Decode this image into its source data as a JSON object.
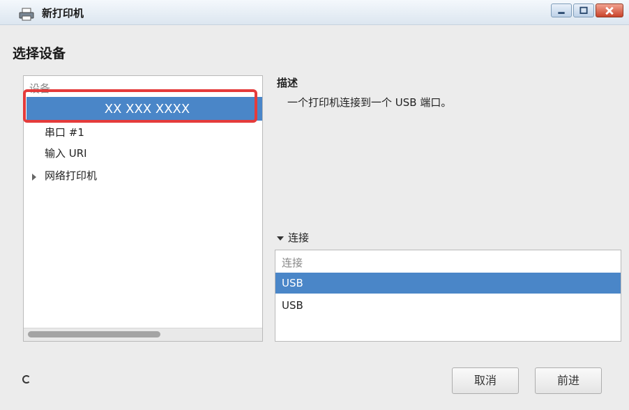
{
  "window": {
    "title": "新打印机",
    "icon": "printer-icon",
    "controls": [
      "minimize-icon",
      "maximize-icon",
      "close-icon"
    ]
  },
  "page": {
    "heading": "选择设备"
  },
  "devices": {
    "column_header": "设备",
    "items": [
      {
        "label": "XX XXX XXXX",
        "selected": true
      },
      {
        "label": "串口 #1"
      },
      {
        "label": "输入 URI"
      },
      {
        "label": "网络打印机",
        "expandable": true
      }
    ]
  },
  "description": {
    "label": "描述",
    "text": "一个打印机连接到一个 USB 端口。"
  },
  "connection": {
    "toggle_label": "连接",
    "column_header": "连接",
    "rows": [
      {
        "label": "USB",
        "selected": true
      },
      {
        "label": "USB"
      }
    ]
  },
  "buttons": {
    "cancel": "取消",
    "forward": "前进"
  },
  "colors": {
    "selection": "#4a86c8",
    "highlight": "#e53b3b"
  }
}
